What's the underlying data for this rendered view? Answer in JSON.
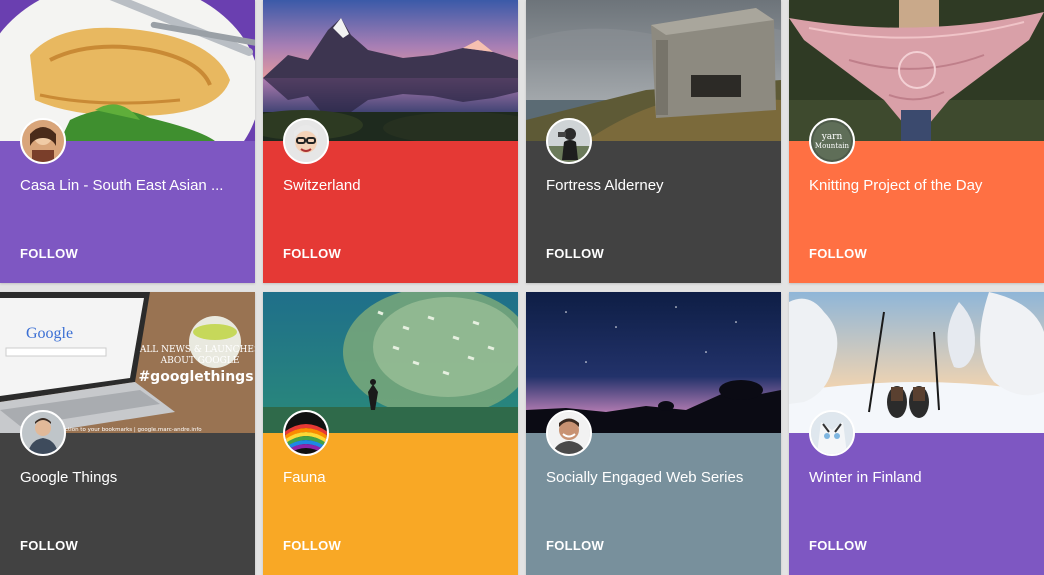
{
  "collections": [
    {
      "title": "Casa Lin - South East Asian ...",
      "follow_label": "FOLLOW",
      "color": "#7e57c2"
    },
    {
      "title": "Switzerland",
      "follow_label": "FOLLOW",
      "color": "#e53935"
    },
    {
      "title": "Fortress Alderney",
      "follow_label": "FOLLOW",
      "color": "#424242"
    },
    {
      "title": "Knitting Project of the Day",
      "follow_label": "FOLLOW",
      "color": "#ff7043"
    },
    {
      "title": "Google Things",
      "follow_label": "FOLLOW",
      "color": "#424242",
      "cover_text": {
        "search_logo": "Google",
        "line1": "ALL NEWS & LAUNCHES",
        "line2": "ABOUT GOOGLE",
        "hashtag": "#googlethings",
        "footer": "ction to your bookmarks | google.marc-andre.info"
      }
    },
    {
      "title": "Fauna",
      "follow_label": "FOLLOW",
      "color": "#f9a825"
    },
    {
      "title": "Socially Engaged Web Series",
      "follow_label": "FOLLOW",
      "color": "#78909c"
    },
    {
      "title": "Winter in Finland",
      "follow_label": "FOLLOW",
      "color": "#7e57c2"
    }
  ],
  "avatar_text": {
    "yarn_line1": "yarn",
    "yarn_line2": "Mountain"
  }
}
